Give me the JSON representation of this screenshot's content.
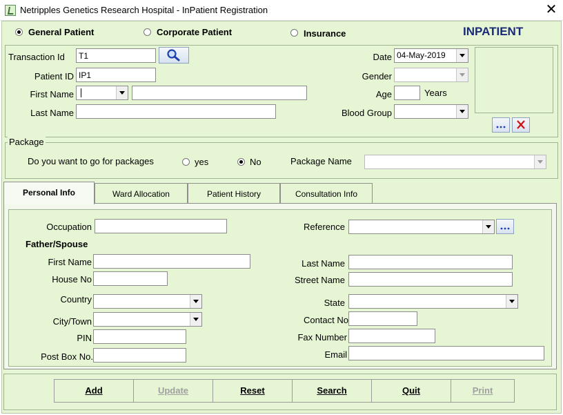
{
  "window": {
    "title": "Netripples Genetics Research Hospital - InPatient Registration"
  },
  "patient_type": {
    "options": [
      "General Patient",
      "Corporate Patient",
      "Insurance"
    ],
    "selected": "General Patient",
    "heading": "INPATIENT"
  },
  "header": {
    "transaction_id_label": "Transaction Id",
    "transaction_id_value": "T1",
    "patient_id_label": "Patient ID",
    "patient_id_value": "IP1",
    "first_name_label": "First Name",
    "title_value": "",
    "first_name_value": "",
    "last_name_label": "Last Name",
    "last_name_value": "",
    "date_label": "Date",
    "date_value": "04-May-2019",
    "gender_label": "Gender",
    "gender_value": "",
    "age_label": "Age",
    "age_value": "",
    "age_unit": "Years",
    "blood_group_label": "Blood Group",
    "blood_group_value": ""
  },
  "package": {
    "group_title": "Package",
    "question": "Do you want to go for packages",
    "yes_label": "yes",
    "no_label": "No",
    "selected": "No",
    "package_name_label": "Package Name",
    "package_name_value": ""
  },
  "tabs": [
    {
      "label": "Personal Info",
      "active": true
    },
    {
      "label": "Ward Allocation",
      "active": false
    },
    {
      "label": "Patient History",
      "active": false
    },
    {
      "label": "Consultation Info",
      "active": false
    }
  ],
  "personal_info": {
    "occupation_label": "Occupation",
    "occupation_value": "",
    "reference_label": "Reference",
    "reference_value": "",
    "father_spouse_heading": "Father/Spouse",
    "first_name_label": "First Name",
    "first_name_value": "",
    "last_name_label": "Last Name",
    "last_name_value": "",
    "house_no_label": "House No",
    "house_no_value": "",
    "street_name_label": "Street Name",
    "street_name_value": "",
    "country_label": "Country",
    "country_value": "",
    "state_label": "State",
    "state_value": "",
    "city_label": "City/Town",
    "city_value": "",
    "contact_no_label": "Contact No",
    "contact_no_value": "",
    "pin_label": "PIN",
    "pin_value": "",
    "fax_label": "Fax Number",
    "fax_value": "",
    "post_box_label": "Post Box No.",
    "post_box_value": "",
    "email_label": "Email",
    "email_value": ""
  },
  "footer": {
    "buttons": [
      {
        "label": "Add",
        "enabled": true
      },
      {
        "label": "Update",
        "enabled": false
      },
      {
        "label": "Reset",
        "enabled": true
      },
      {
        "label": "Search",
        "enabled": true
      },
      {
        "label": "Quit",
        "enabled": true
      },
      {
        "label": "Print",
        "enabled": false
      }
    ]
  },
  "icons": {
    "search": "magnifier-icon",
    "browse": "ellipsis-icon",
    "delete": "red-x-icon"
  },
  "colors": {
    "panel": "#e6f5d4",
    "heading_blue": "#1a2a7a",
    "delete_red": "#d01010",
    "search_blue": "#1b3fae"
  }
}
